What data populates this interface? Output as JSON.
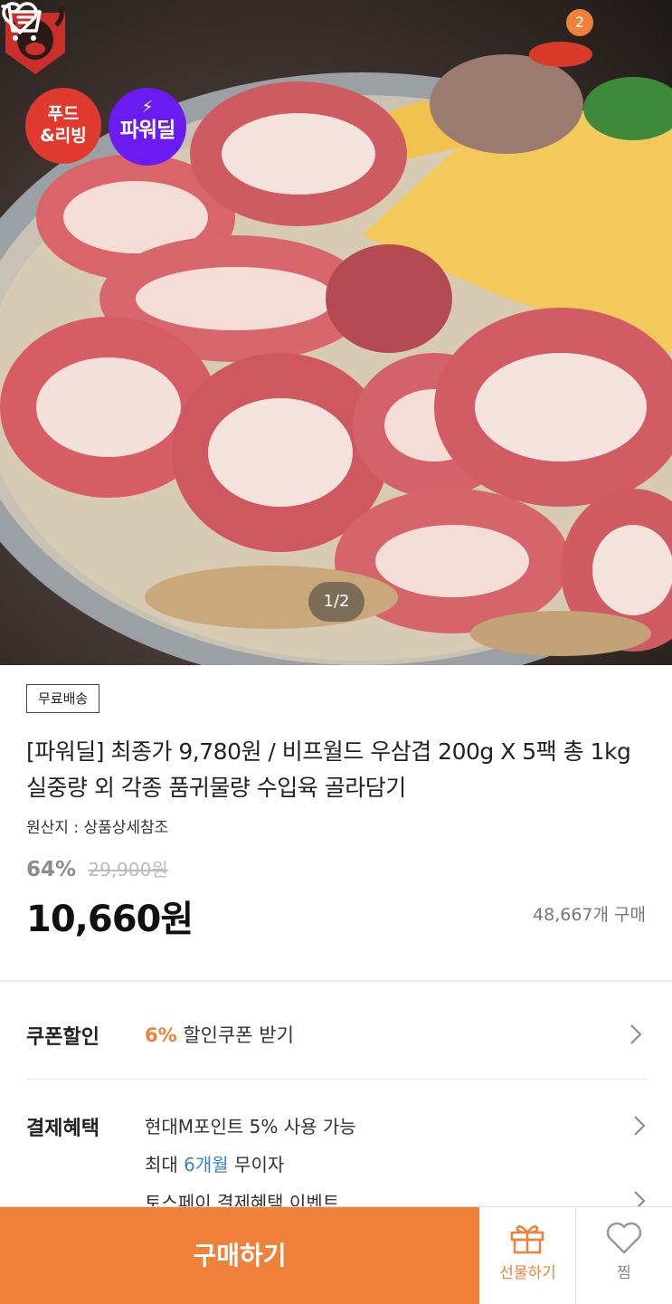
{
  "hero": {
    "image_counter": "1/2",
    "badges": {
      "food_line1": "푸드",
      "food_line2": "&리빙",
      "power": "파워딜",
      "power_bolt": "⚡"
    },
    "wishlist_count": "2"
  },
  "product": {
    "free_shipping": "무료배송",
    "title": "[파워딜] 최종가 9,780원 / 비프월드 우삼겹 200g X 5팩 총 1kg 실중량 외 각종 품귀물량 수입육 골라담기",
    "origin": "원산지 : 상품상세참조",
    "discount_rate": "64%",
    "original_price": "29,900원",
    "price": "10,660원",
    "purchase_count": "48,667개 구매"
  },
  "coupon": {
    "label": "쿠폰할인",
    "percent": "6%",
    "text": " 할인쿠폰 받기"
  },
  "payment": {
    "label": "결제혜택",
    "line1": "현대M포인트 5% 사용 가능",
    "line2_prefix": "최대 ",
    "line2_highlight": "6개월",
    "line2_suffix": " 무이자",
    "line3": "토스페이 결제혜택 이벤트"
  },
  "bottom_bar": {
    "buy_label": "구매하기",
    "gift_label": "선물하기",
    "wish_label": "찜"
  },
  "colors": {
    "accent": "#f0813a",
    "power_purple": "#6a1cf0",
    "food_red": "#e03a2e",
    "link_blue": "#3b7fd2"
  },
  "icons": [
    "back-arrow-icon",
    "brand-logo",
    "heart-icon",
    "cart-icon",
    "chevron-right-icon",
    "gift-icon"
  ]
}
